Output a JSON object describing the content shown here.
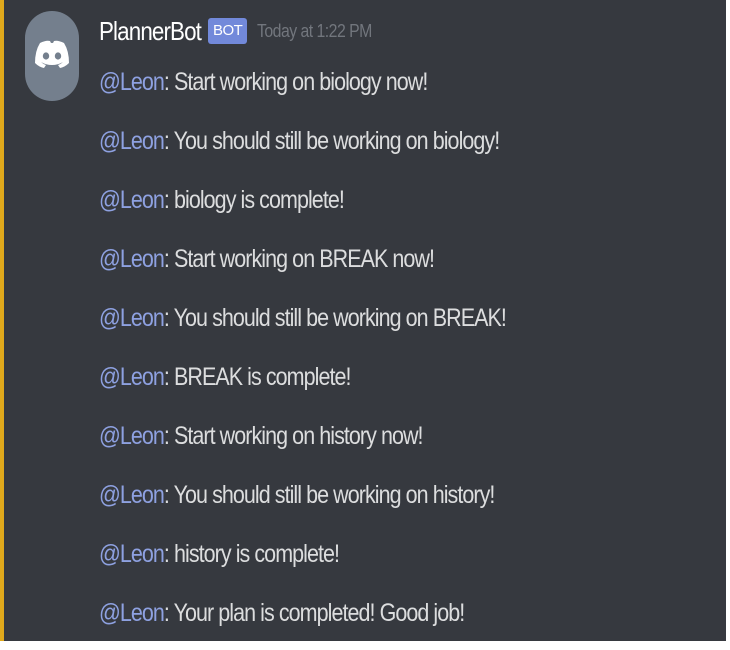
{
  "message_group": {
    "author": "PlannerBot",
    "bot_tag": "BOT",
    "timestamp": "Today at 1:22 PM",
    "avatar_icon": "discord-logo-icon",
    "avatar_color": "#747f8d",
    "messages": [
      {
        "mention": "@Leon",
        "text": ":  Start working on biology now!"
      },
      {
        "mention": "@Leon",
        "text": ": You should still be working on biology!"
      },
      {
        "mention": "@Leon",
        "text": ": biology is complete!"
      },
      {
        "mention": "@Leon",
        "text": ":  Start working on BREAK now!"
      },
      {
        "mention": "@Leon",
        "text": ": You should still be working on BREAK!"
      },
      {
        "mention": "@Leon",
        "text": ": BREAK is complete!"
      },
      {
        "mention": "@Leon",
        "text": ":  Start working on history now!"
      },
      {
        "mention": "@Leon",
        "text": ": You should still be working on history!"
      },
      {
        "mention": "@Leon",
        "text": ": history is complete!"
      },
      {
        "mention": "@Leon",
        "text": ": Your plan is completed! Good job!"
      }
    ]
  },
  "colors": {
    "background": "#36393f",
    "accent_border": "#e0a91c",
    "mention": "#8ea1e1",
    "message_text": "#dcddde",
    "bot_tag": "#7289da",
    "timestamp": "#72767d"
  }
}
